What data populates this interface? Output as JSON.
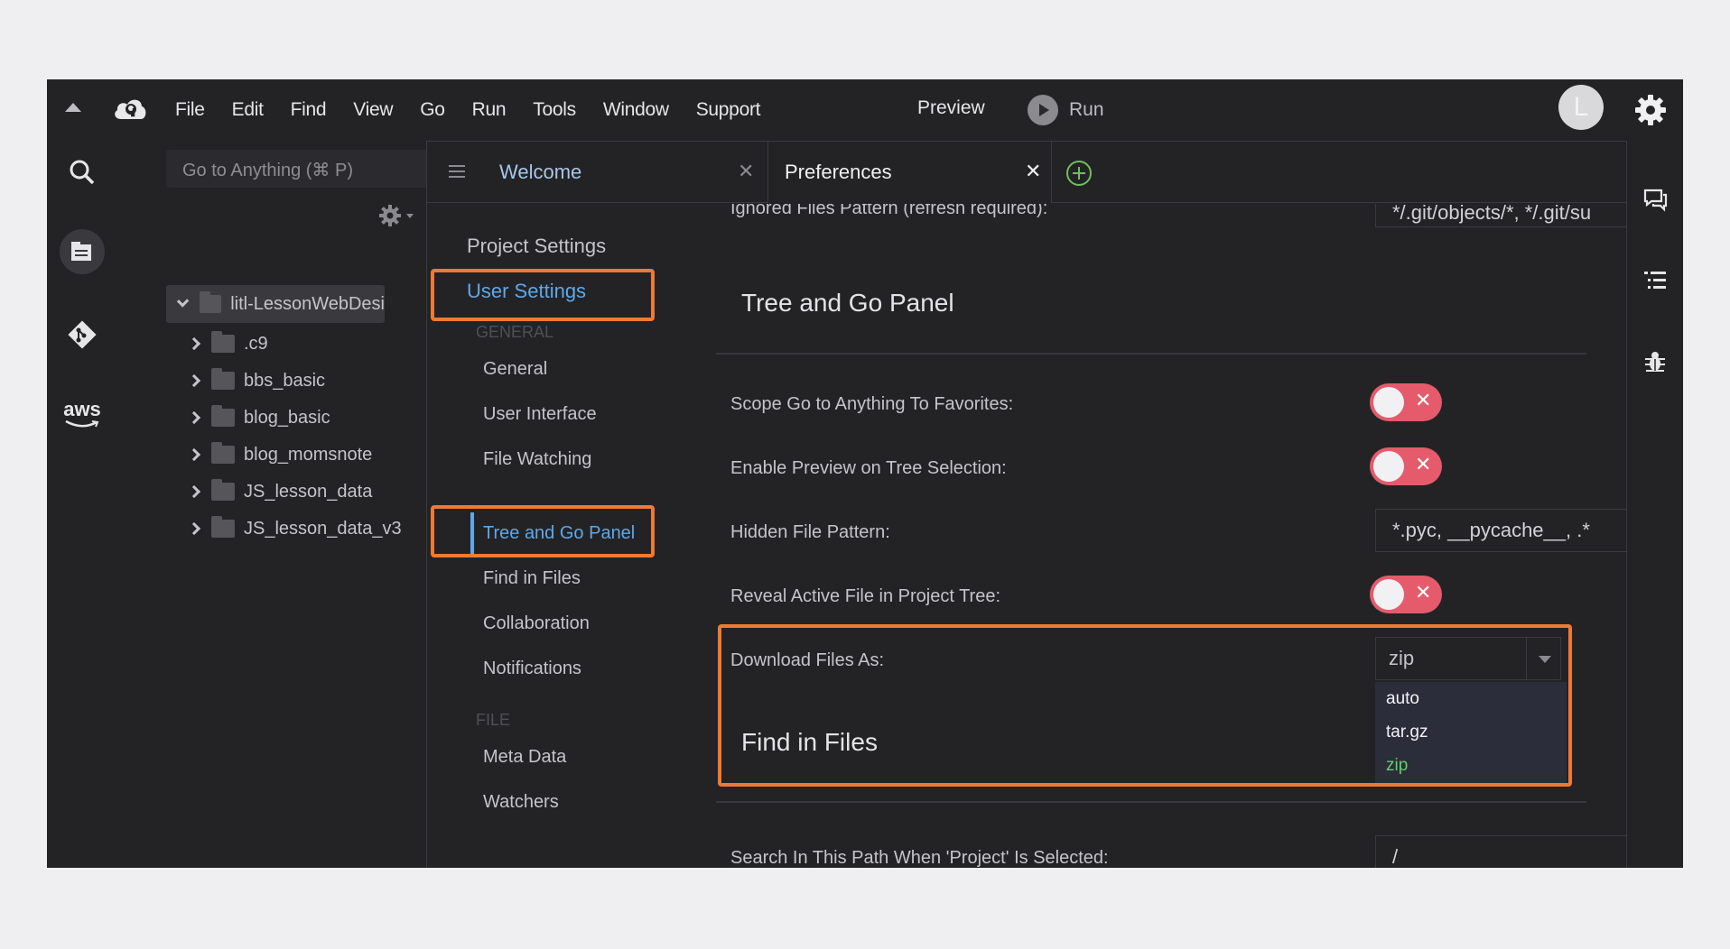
{
  "menubar": {
    "items": [
      "File",
      "Edit",
      "Find",
      "View",
      "Go",
      "Run",
      "Tools",
      "Window",
      "Support"
    ],
    "preview_label": "Preview",
    "run_label": "Run",
    "avatar_initial": "L"
  },
  "sidebar": {
    "search_placeholder": "Go to Anything (⌘ P)",
    "root_folder": "litl-LessonWebDesi",
    "folders": [
      ".c9",
      "bbs_basic",
      "blog_basic",
      "blog_momsnote",
      "JS_lesson_data",
      "JS_lesson_data_v3"
    ],
    "activity_icons": [
      "search-icon",
      "files-icon",
      "git-icon",
      "aws-icon"
    ],
    "aws_label": "aws"
  },
  "tabs": [
    {
      "label": "Welcome",
      "active": false
    },
    {
      "label": "Preferences",
      "active": true
    }
  ],
  "prefs_nav": {
    "project_settings": "Project Settings",
    "user_settings": "User Settings",
    "general_heading": "GENERAL",
    "general_items": [
      "General",
      "User Interface",
      "File Watching",
      "Tree and Go Panel",
      "Find in Files",
      "Collaboration",
      "Notifications"
    ],
    "file_heading": "FILE",
    "file_items": [
      "Meta Data",
      "Watchers"
    ],
    "selected": "Tree and Go Panel"
  },
  "prefs_content": {
    "ignored_label": "Ignored Files Pattern (refresh required):",
    "ignored_value": "*/.git/objects/*, */.git/su",
    "section_title": "Tree and Go Panel",
    "scope_label": "Scope Go to Anything To Favorites:",
    "scope_enabled": false,
    "preview_label": "Enable Preview on Tree Selection:",
    "preview_enabled": false,
    "hidden_label": "Hidden File Pattern:",
    "hidden_value": "*.pyc, __pycache__, .*",
    "reveal_label": "Reveal Active File in Project Tree:",
    "reveal_enabled": false,
    "download_label": "Download Files As:",
    "download_value": "zip",
    "download_options": [
      "auto",
      "tar.gz",
      "zip"
    ],
    "find_section_title": "Find in Files",
    "search_path_label": "Search In This Path When 'Project' Is Selected:",
    "search_path_value": "/"
  },
  "colors": {
    "highlight": "#ee7a33",
    "accent_blue": "#5fa8e8",
    "toggle_off": "#e55b6b",
    "selected_option": "#5fd06a"
  }
}
